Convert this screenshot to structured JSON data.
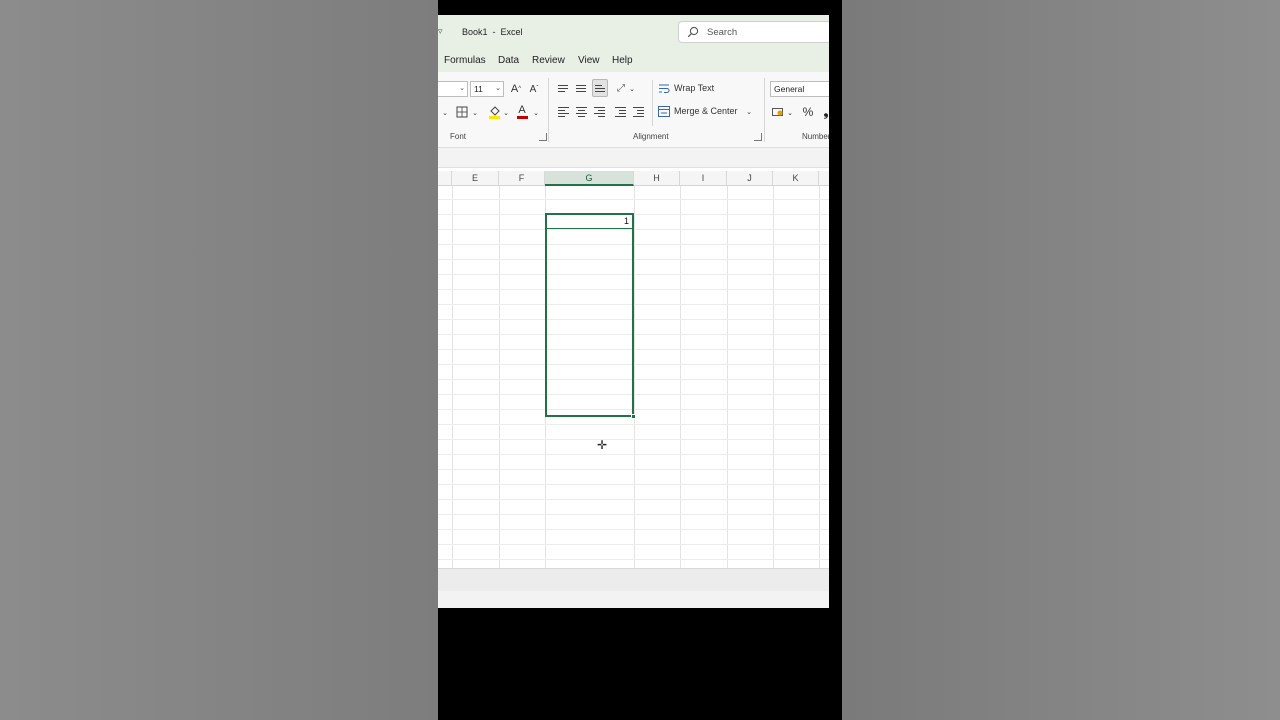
{
  "window": {
    "title": "Book1  -  Excel",
    "qa_arrow": "▿"
  },
  "search": {
    "placeholder": "Search"
  },
  "menu": [
    "Formulas",
    "Data",
    "Review",
    "View",
    "Help"
  ],
  "ribbon": {
    "font_size": "11",
    "grow_font": "A",
    "shrink_font": "A",
    "font_color_letter": "A",
    "wrap_text": "Wrap Text",
    "merge_center": "Merge & Center",
    "number_format": "General",
    "percent": "%",
    "groups": {
      "font": "Font",
      "alignment": "Alignment",
      "number": "Number"
    }
  },
  "columns": [
    "E",
    "F",
    "G",
    "H",
    "I",
    "J",
    "K"
  ],
  "active_column": "G",
  "active_cell": {
    "value": "1"
  },
  "colors": {
    "excel_green": "#217346",
    "title_bg": "#e8f0e6",
    "font_red": "#c00000",
    "highlight_yellow": "#ffe600"
  }
}
